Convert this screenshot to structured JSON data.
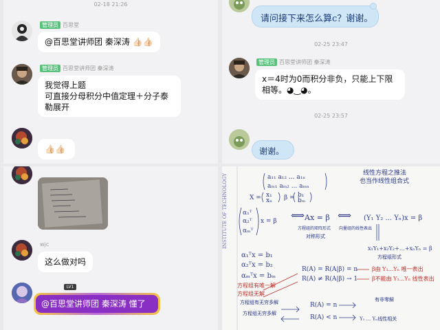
{
  "panel1": {
    "time": "02-18 21:26",
    "badge1": "管理员",
    "sender1": "百思堂",
    "msg1": "@百思堂讲师团 秦深涛 👍🏻👍🏻",
    "badge2": "管理员",
    "sender2": "百思堂讲师团 秦深涛",
    "msg2_l1": "我觉得上题",
    "msg2_l2": "可直接分母积分中值定理＋分子泰",
    "msg2_l3": "勒展开",
    "msg3": "👍🏻👍🏻"
  },
  "panel2": {
    "msg1": "请问接下来怎么算c？谢谢。",
    "time1": "02-25 23:47",
    "badge": "管理员",
    "sender": "百思堂讲师团 秦深涛",
    "msg2_l1": "x＝4时为0而积分非负，只能上下限",
    "msg2_l2": "相等。◕‿◕。",
    "time2": "02-25 23:57",
    "msg3": "谢谢。"
  },
  "panel3": {
    "sender": "wjc",
    "msg1": "这么做对吗",
    "msg2": "@百思堂讲师团 秦深涛 懂了",
    "level_badge": "LV1"
  },
  "panel4": {
    "side_text": "INSTITUTE OF TECHNOLOGY",
    "note_top1": "线性方程之推法",
    "note_top2": "也当作线性组合式",
    "m_label1": "α₁ᵀ",
    "m_label2": "α₂ᵀ",
    "m_label3": "αₘᵀ",
    "eq_x": "x = β",
    "eq_ax": "Ax = β",
    "eq_y": "(Y₁ Y₂ ... Yₙ)x = β",
    "note_a": "方程组的矩阵形式",
    "note_b": "向量组的线性表出",
    "note_c": "对称形式",
    "eq1": "α₁ᵀx = b₁",
    "eq2": "α₂ᵀx = b₂",
    "eq3": "αₘᵀx = bₘ",
    "eq_lin": "x₁Y₁+x₂Y₂+…+xₙYₙ = β",
    "note_d": "方程组形式",
    "rank1": "R(A) = R(A|β) = n",
    "rank2": "R(A) ≠ R(A|β) → 1",
    "note_e": "β由 Y₁...Yₙ 唯一表出",
    "note_f": "β不能由 Y₁...Yₙ 线性表出",
    "rank3": "R(A) = n",
    "rank4": "R(A) < n",
    "note_g": "方程组无穷多解",
    "note_h": "有非零解",
    "note_i": "向量组 Y₁...Yₙ 线性相关",
    "note_j": "Y₁ ... Yₙ线性相关"
  }
}
